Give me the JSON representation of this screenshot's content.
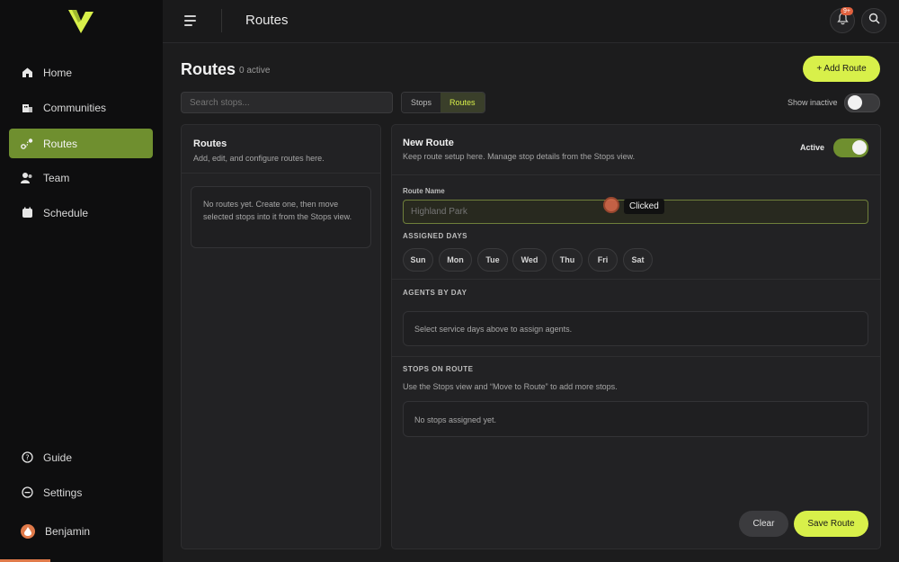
{
  "sidebar": {
    "items": [
      {
        "label": "Home",
        "icon": "home-icon"
      },
      {
        "label": "Communities",
        "icon": "building-icon"
      },
      {
        "label": "Routes",
        "icon": "route-icon",
        "active": true
      },
      {
        "label": "Team",
        "icon": "team-icon"
      },
      {
        "label": "Schedule",
        "icon": "calendar-icon"
      }
    ],
    "guide_label": "Guide",
    "settings_label": "Settings",
    "user_name": "Benjamin"
  },
  "topbar": {
    "title": "Routes",
    "notification_badge": "9+"
  },
  "page": {
    "title": "Routes",
    "subtitle": "0 active",
    "add_button": "+ Add Route",
    "search_placeholder": "Search stops...",
    "view_tabs": [
      "Stops",
      "Routes"
    ],
    "active_view": "Routes",
    "show_inactive_label": "Show inactive",
    "show_inactive_on": false
  },
  "routes_panel": {
    "title": "Routes",
    "subtitle": "Add, edit, and configure routes here.",
    "empty_text": "No routes yet. Create one, then move selected stops into it from the Stops view."
  },
  "editor": {
    "title": "New Route",
    "subtitle": "Keep route setup here. Manage stop details from the Stops view.",
    "active_label": "Active",
    "active_on": true,
    "route_name_label": "Route Name",
    "route_name_placeholder": "Highland Park",
    "assigned_days_label": "ASSIGNED DAYS",
    "days": [
      "Sun",
      "Mon",
      "Tue",
      "Wed",
      "Thu",
      "Fri",
      "Sat"
    ],
    "agents_label": "AGENTS BY DAY",
    "agents_empty": "Select service days above to assign agents.",
    "stops_label": "STOPS ON ROUTE",
    "stops_hint": "Use the Stops view and “Move to Route” to add more stops.",
    "stops_empty": "No stops assigned yet.",
    "clear_button": "Clear",
    "save_button": "Save Route"
  },
  "overlay": {
    "tooltip": "Clicked"
  },
  "colors": {
    "accent": "#d8f04a",
    "nav_active": "#6f8f2f",
    "badge": "#e0613e"
  }
}
